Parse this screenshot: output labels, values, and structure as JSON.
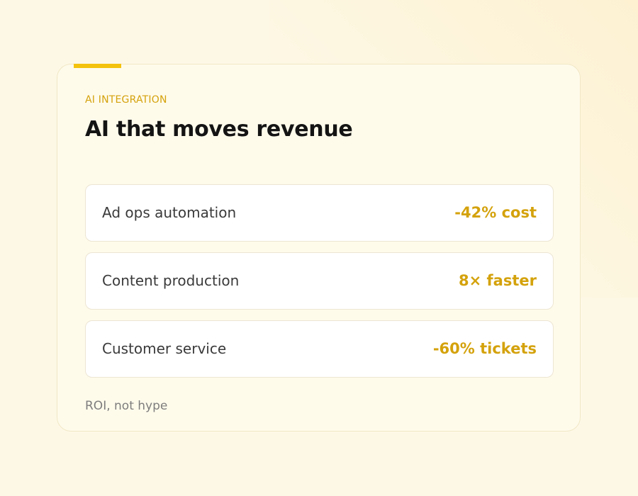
{
  "card": {
    "eyebrow": "AI INTEGRATION",
    "title": "AI that moves revenue",
    "metrics": [
      {
        "label": "Ad ops automation",
        "value": "-42% cost"
      },
      {
        "label": "Content production",
        "value": "8× faster"
      },
      {
        "label": "Customer service",
        "value": "-60% tickets"
      }
    ],
    "footnote": "ROI, not hype"
  },
  "colors": {
    "background": "#fdf8e6",
    "card_background": "#fffbeb",
    "accent": "#f4c20d",
    "eyebrow_and_values": "#d4a20c",
    "title": "#141414",
    "label": "#3a3a3a",
    "footnote": "#7d7d7d"
  }
}
